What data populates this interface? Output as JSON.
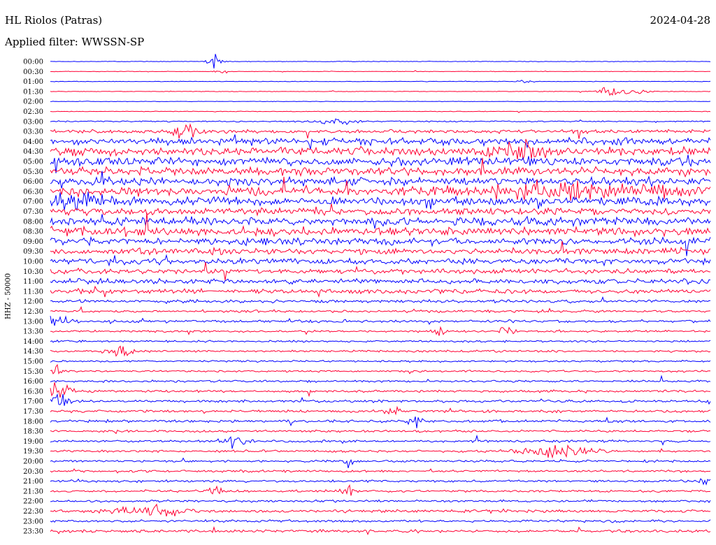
{
  "header": {
    "station": "HL Riolos (Patras)",
    "date": "2024-04-28",
    "filter": "Applied filter: WWSSN-SP",
    "channel": "HHZ - 50000"
  },
  "colors": {
    "trace_a": "#0000ff",
    "trace_b": "#ff0033"
  },
  "chart_data": {
    "type": "line",
    "title": "HL Riolos (Patras)",
    "subtitle": "Applied filter: WWSSN-SP",
    "xlabel": "",
    "ylabel": "HHZ - 50000",
    "grid": false,
    "legend": "none",
    "y_categories": [
      "00:00",
      "00:30",
      "01:00",
      "01:30",
      "02:00",
      "02:30",
      "03:00",
      "03:30",
      "04:00",
      "04:30",
      "05:00",
      "05:30",
      "06:00",
      "06:30",
      "07:00",
      "07:30",
      "08:00",
      "08:30",
      "09:00",
      "09:30",
      "10:00",
      "10:30",
      "11:00",
      "11:30",
      "12:00",
      "12:30",
      "13:00",
      "13:30",
      "14:00",
      "14:30",
      "15:00",
      "15:30",
      "16:00",
      "16:30",
      "17:00",
      "17:30",
      "18:00",
      "18:30",
      "19:00",
      "19:30",
      "20:00",
      "20:30",
      "21:00",
      "21:30",
      "22:00",
      "22:30",
      "23:00",
      "23:30"
    ],
    "noise_level": [
      0.6,
      0.5,
      0.6,
      0.5,
      0.5,
      0.6,
      1.2,
      3.5,
      7,
      8,
      8,
      8,
      8,
      8,
      8,
      7,
      8,
      8,
      7,
      6,
      5.5,
      5,
      5,
      4.5,
      3,
      2.5,
      2.5,
      2,
      2,
      2,
      1.8,
      1.8,
      2,
      2.2,
      2.5,
      2.5,
      2.5,
      2.2,
      2.2,
      2.2,
      2.2,
      2.2,
      2.2,
      2.2,
      2.2,
      2.8,
      2.4,
      2.8
    ],
    "events": [
      {
        "row": 0,
        "x": 0.25,
        "amp": 14,
        "width": 0.01
      },
      {
        "row": 1,
        "x": 0.26,
        "amp": 4,
        "width": 0.01
      },
      {
        "row": 2,
        "x": 0.72,
        "amp": 5,
        "width": 0.01
      },
      {
        "row": 3,
        "x": 0.87,
        "amp": 7,
        "width": 0.03
      },
      {
        "row": 3,
        "x": 0.84,
        "amp": 9,
        "width": 0.01
      },
      {
        "row": 6,
        "x": 0.43,
        "amp": 6,
        "width": 0.03
      },
      {
        "row": 7,
        "x": 0.2,
        "amp": 14,
        "width": 0.02
      },
      {
        "row": 9,
        "x": 0.71,
        "amp": 16,
        "width": 0.04
      },
      {
        "row": 13,
        "x": 0.8,
        "amp": 12,
        "width": 0.16
      },
      {
        "row": 14,
        "x": 0.04,
        "amp": 14,
        "width": 0.05
      },
      {
        "row": 26,
        "x": 0.01,
        "amp": 10,
        "width": 0.02
      },
      {
        "row": 27,
        "x": 0.59,
        "amp": 12,
        "width": 0.01
      },
      {
        "row": 27,
        "x": 0.69,
        "amp": 10,
        "width": 0.01
      },
      {
        "row": 29,
        "x": 0.11,
        "amp": 12,
        "width": 0.02
      },
      {
        "row": 31,
        "x": 0.01,
        "amp": 10,
        "width": 0.01
      },
      {
        "row": 33,
        "x": 0.01,
        "amp": 18,
        "width": 0.02
      },
      {
        "row": 34,
        "x": 0.01,
        "amp": 16,
        "width": 0.02
      },
      {
        "row": 35,
        "x": 0.52,
        "amp": 10,
        "width": 0.01
      },
      {
        "row": 36,
        "x": 0.55,
        "amp": 12,
        "width": 0.01
      },
      {
        "row": 38,
        "x": 0.28,
        "amp": 10,
        "width": 0.02
      },
      {
        "row": 39,
        "x": 0.77,
        "amp": 12,
        "width": 0.05
      },
      {
        "row": 40,
        "x": 0.45,
        "amp": 10,
        "width": 0.01
      },
      {
        "row": 42,
        "x": 0.99,
        "amp": 8,
        "width": 0.01
      },
      {
        "row": 43,
        "x": 0.25,
        "amp": 14,
        "width": 0.01
      },
      {
        "row": 43,
        "x": 0.45,
        "amp": 14,
        "width": 0.01
      },
      {
        "row": 45,
        "x": 0.15,
        "amp": 10,
        "width": 0.05
      }
    ]
  }
}
